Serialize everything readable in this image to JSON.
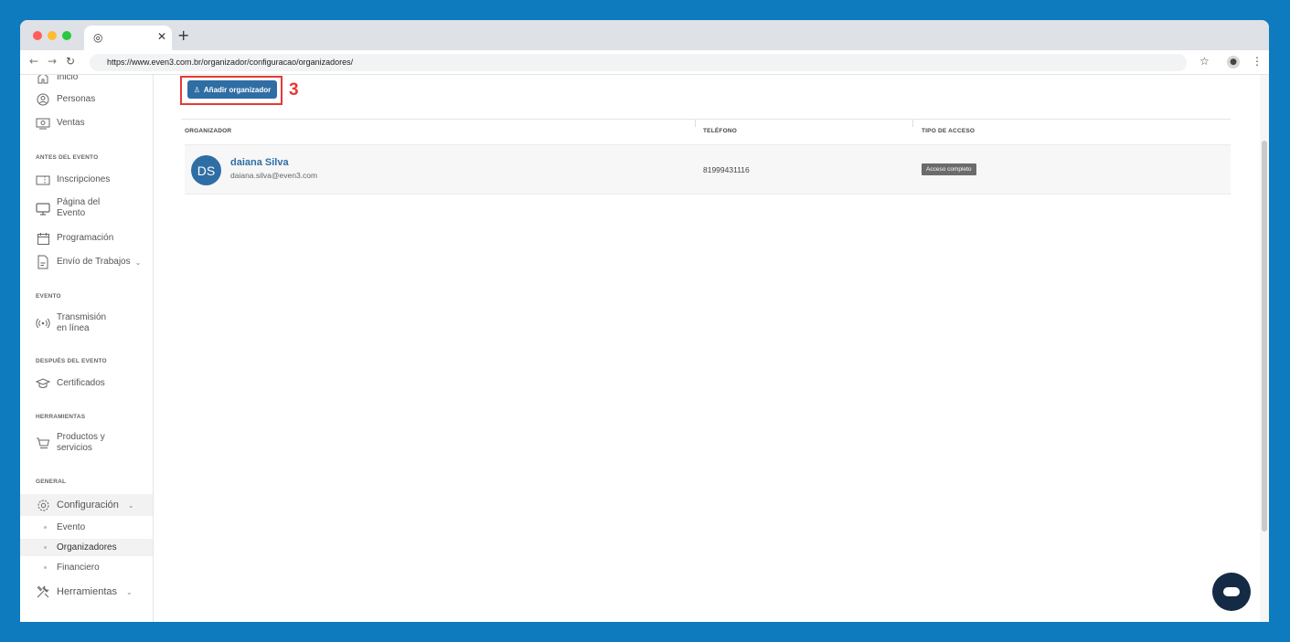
{
  "browser": {
    "tab_favicon": "chrome-icon",
    "url": "https://www.even3.com.br/organizador/configuracao/organizadores/"
  },
  "sidebar": {
    "items_top": [
      {
        "label": "Inicio",
        "icon": "home-icon"
      },
      {
        "label": "Personas",
        "icon": "person-icon"
      },
      {
        "label": "Ventas",
        "icon": "money-icon"
      }
    ],
    "sections": [
      {
        "title": "ANTES DEL EVENTO"
      },
      {
        "title": "EVENTO"
      },
      {
        "title": "DESPUÉS DEL EVENTO"
      },
      {
        "title": "HERRAMIENTAS"
      },
      {
        "title": "GENERAL"
      }
    ],
    "antes": [
      "Inscripciones",
      "Página del\nEvento",
      "Programación",
      "Envío de Trabajos"
    ],
    "evento": [
      "Transmisión\nen línea"
    ],
    "despues": [
      "Certificados"
    ],
    "herramientas": [
      "Productos y\nservicios"
    ],
    "general": {
      "configuracion": "Configuración",
      "sub": [
        "Evento",
        "Organizadores",
        "Financiero"
      ],
      "herramientas": "Herramientas"
    }
  },
  "main": {
    "add_button": "Añadir organizador",
    "annotation": "3",
    "table": {
      "headers": [
        "ORGANIZADOR",
        "TELÉFONO",
        "TIPO DE ACCESO"
      ],
      "rows": [
        {
          "initials": "DS",
          "name": "daiana Silva",
          "email": "daiana.silva@even3.com",
          "phone": "81999431116",
          "access": "Acceso completo"
        }
      ]
    }
  },
  "colors": {
    "background": "#0e7bbf",
    "accent": "#2f6ea4",
    "annotation": "#e53935",
    "chat": "#152a45"
  }
}
